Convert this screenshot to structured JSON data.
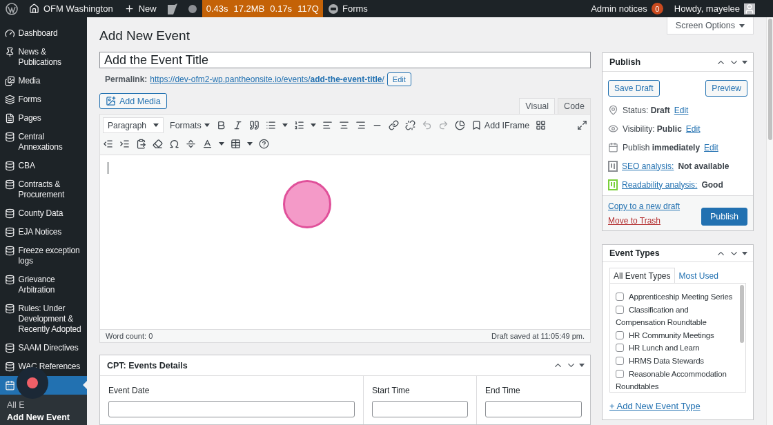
{
  "admin_bar": {
    "site": "OFM Washington",
    "new": "New",
    "perf": [
      "0.43s",
      "17.2MB",
      "0.17s",
      "117Q"
    ],
    "forms": "Forms",
    "notices": {
      "label": "Admin notices",
      "count": "0"
    },
    "greeting": "Howdy, mayelee"
  },
  "sidebar": {
    "items": [
      {
        "label": "Dashboard",
        "selected": false
      },
      {
        "label": "News & Publications",
        "selected": false
      },
      {
        "label": "Media",
        "selected": false
      },
      {
        "label": "Forms",
        "selected": false
      },
      {
        "label": "Pages",
        "selected": false
      },
      {
        "label": "Central Annexations",
        "selected": false
      },
      {
        "label": "CBA",
        "selected": false
      },
      {
        "label": "Contracts & Procurement",
        "selected": false
      },
      {
        "label": "County Data",
        "selected": false
      },
      {
        "label": "EJA Notices",
        "selected": false
      },
      {
        "label": "Freeze exception logs",
        "selected": false
      },
      {
        "label": "Grievance Arbitration",
        "selected": false
      },
      {
        "label": "Rules: Under Development & Recently Adopted",
        "selected": false
      },
      {
        "label": "SAAM Directives",
        "selected": false
      },
      {
        "label": "WAC References",
        "selected": false
      },
      {
        "selected": true
      }
    ],
    "submenu": [
      {
        "label": "All E",
        "selected": false
      },
      {
        "label": "Add New Event",
        "selected": true
      }
    ]
  },
  "page": {
    "title": "Add New Event",
    "screen_options": "Screen Options"
  },
  "editor": {
    "title_value": "Add the Event Title",
    "permalink_label": "Permalink:",
    "permalink_url": "https://dev-ofm2-wp.pantheonsite.io/events/**add-the-event-title**/",
    "permalink_edit": "Edit",
    "add_media": "Add Media",
    "tabs": [
      {
        "label": "Visual",
        "selected": true
      },
      {
        "label": "Code",
        "selected": false
      }
    ],
    "format_select": "Paragraph",
    "formats": "Formats",
    "add_iframe": "Add IFrame",
    "word_count": "Word count: 0",
    "draft_saved": "Draft saved at 11:05:49 pm."
  },
  "cpt_box": {
    "title": "CPT: Events Details",
    "fields": [
      {
        "label": "Event Date"
      },
      {
        "label": "Start Time"
      },
      {
        "label": "End Time"
      }
    ]
  },
  "publish": {
    "title": "Publish",
    "save_draft": "Save Draft",
    "preview": "Preview",
    "rows": [
      {
        "kind": "meta",
        "label": "Status:",
        "value": "Draft",
        "link": "Edit"
      },
      {
        "kind": "meta",
        "label": "Visibility:",
        "value": "Public",
        "link": "Edit"
      },
      {
        "kind": "meta",
        "label": "Publish",
        "value": "immediately",
        "link": "Edit"
      },
      {
        "kind": "seo",
        "link": "SEO analysis:",
        "value": "Not available",
        "color": "#8c8f94"
      },
      {
        "kind": "seo",
        "link": "Readability analysis:",
        "value": "Good",
        "color": "#7ad03a"
      }
    ],
    "copy": "Copy to a new draft",
    "trash": "Move to Trash",
    "publish": "Publish"
  },
  "event_types": {
    "title": "Event Types",
    "tabs": [
      {
        "label": "All Event Types",
        "selected": true
      },
      {
        "label": "Most Used",
        "selected": false
      }
    ],
    "items": [
      {
        "label": "Apprenticeship Meeting Series",
        "checked": false
      },
      {
        "label": "Classification and Compensation Roundtable",
        "checked": false
      },
      {
        "label": "HR Community Meetings",
        "checked": false
      },
      {
        "label": "HR Lunch and Learn",
        "checked": false
      },
      {
        "label": "HRMS Data Stewards",
        "checked": false
      },
      {
        "label": "Reasonable Accommodation Roundtables",
        "checked": false
      }
    ],
    "add_link": "+ Add New Event Type"
  }
}
